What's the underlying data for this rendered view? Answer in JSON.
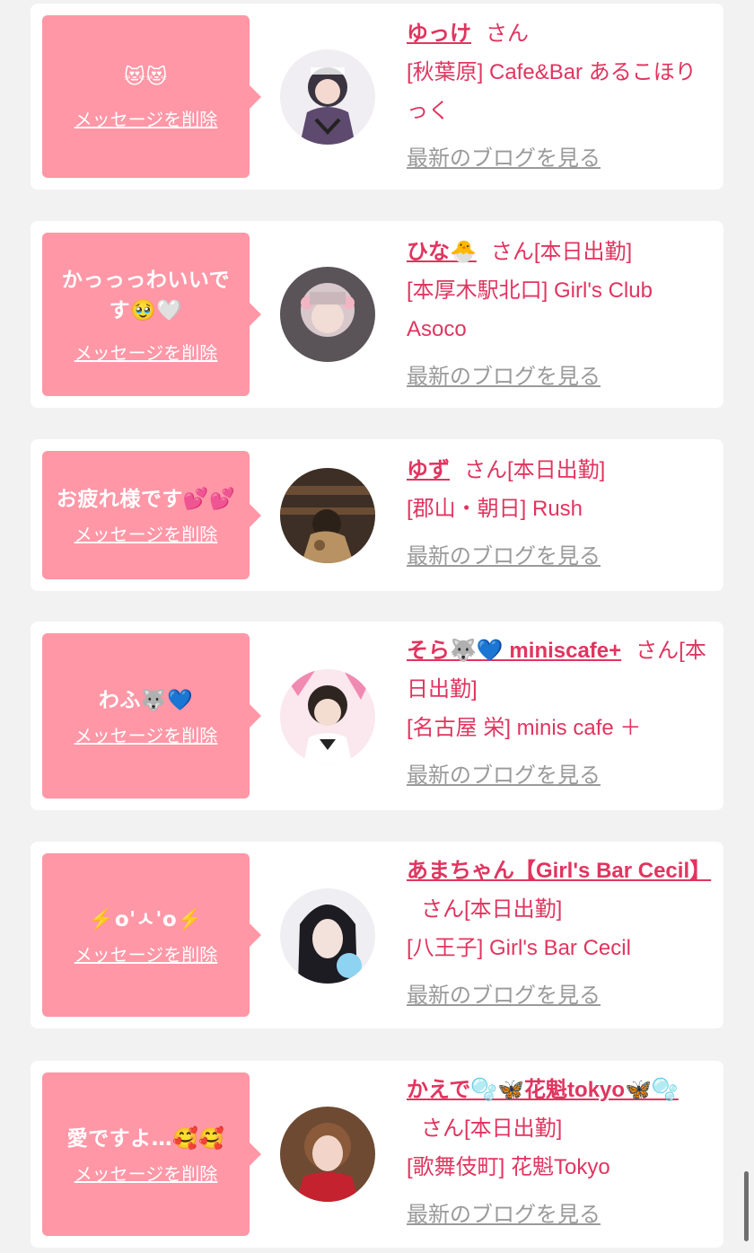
{
  "colors": {
    "bubble": "#ff97a6",
    "accent": "#e0355f",
    "link_gray": "#9a9a9a",
    "page_bg": "#f2f2f2"
  },
  "common": {
    "delete_label": "メッセージを削除",
    "blog_label": "最新のブログを見る",
    "san": "さん"
  },
  "cards": [
    {
      "message": "😻😻",
      "name": "ゆっけ",
      "tag": "",
      "shop": "[秋葉原] Cafe&Bar あるこほりっく"
    },
    {
      "message": "かっっっわいいです🥹🤍",
      "name": "ひな🐣",
      "tag": "[本日出勤]",
      "shop": "[本厚木駅北口] Girl's Club Asoco"
    },
    {
      "message": "お疲れ様です💕💕",
      "name": "ゆず",
      "tag": "[本日出勤]",
      "shop": "[郡山・朝日] Rush"
    },
    {
      "message": "わふ🐺💙",
      "name": "そら🐺💙 miniscafe+",
      "tag": "[本日出勤]",
      "shop": "[名古屋 栄] minis cafe ＋"
    },
    {
      "message": "⚡️o'ㅅ'o⚡️",
      "name": "あまちゃん【Girl's Bar Cecil】",
      "tag": "[本日出勤]",
      "shop": "[八王子] Girl's Bar Cecil"
    },
    {
      "message": "愛ですよ…🥰🥰",
      "name": "かえで🫧🦋花魁tokyo🦋🫧",
      "tag": "[本日出勤]",
      "shop": "[歌舞伎町] 花魁Tokyo"
    }
  ]
}
